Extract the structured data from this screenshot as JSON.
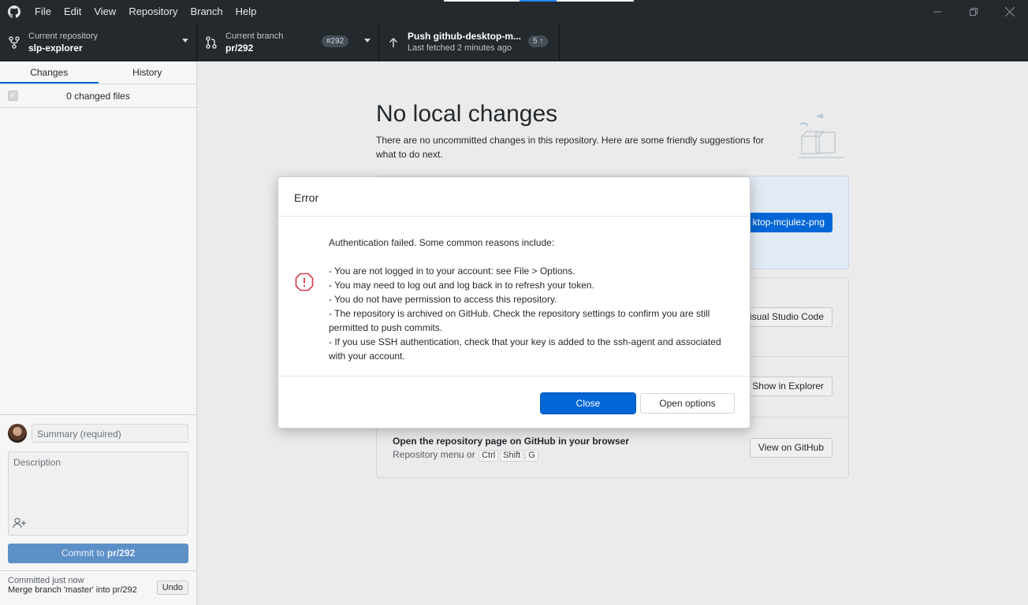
{
  "titlebar": {
    "menu": [
      "File",
      "Edit",
      "View",
      "Repository",
      "Branch",
      "Help"
    ]
  },
  "toolbar": {
    "repo": {
      "title": "Current repository",
      "value": "slp-explorer"
    },
    "branch": {
      "title": "Current branch",
      "value": "pr/292",
      "pr_badge": "#292"
    },
    "push": {
      "title": "Push github-desktop-m...",
      "subtitle": "Last fetched 2 minutes ago",
      "count": "5 ↑"
    }
  },
  "sidebar": {
    "tabs": {
      "changes": "Changes",
      "history": "History"
    },
    "changed_files": "0 changed files",
    "summary_placeholder": "Summary (required)",
    "description_placeholder": "Description",
    "commit_button_prefix": "Commit to ",
    "commit_button_branch": "pr/292",
    "last_commit": {
      "when": "Committed just now",
      "message": "Merge branch 'master' into pr/292",
      "undo": "Undo"
    }
  },
  "main": {
    "title": "No local changes",
    "description": "There are no uncommitted changes in this repository. Here are some friendly suggestions for what to do next.",
    "publish_button": "ktop-mcjulez-png",
    "rows": [
      {
        "button": "isual Studio Code"
      },
      {
        "button": "Show in Explorer"
      },
      {
        "title": "Open the repository page on GitHub in your browser",
        "sub_prefix": "Repository menu or",
        "keys": [
          "Ctrl",
          "Shift",
          "G"
        ],
        "button": "View on GitHub"
      }
    ]
  },
  "modal": {
    "title": "Error",
    "intro": "Authentication failed. Some common reasons include:",
    "reasons": [
      "- You are not logged in to your account: see File > Options.",
      "- You may need to log out and log back in to refresh your token.",
      "- You do not have permission to access this repository.",
      "- The repository is archived on GitHub. Check the repository settings to confirm you are still permitted to push commits.",
      "- If you use SSH authentication, check that your key is added to the ssh-agent and associated with your account."
    ],
    "close_button": "Close",
    "options_button": "Open options"
  },
  "colors": {
    "accent": "#0366d6",
    "toolbar_bg": "#24292e",
    "error_icon": "#d73a49"
  }
}
